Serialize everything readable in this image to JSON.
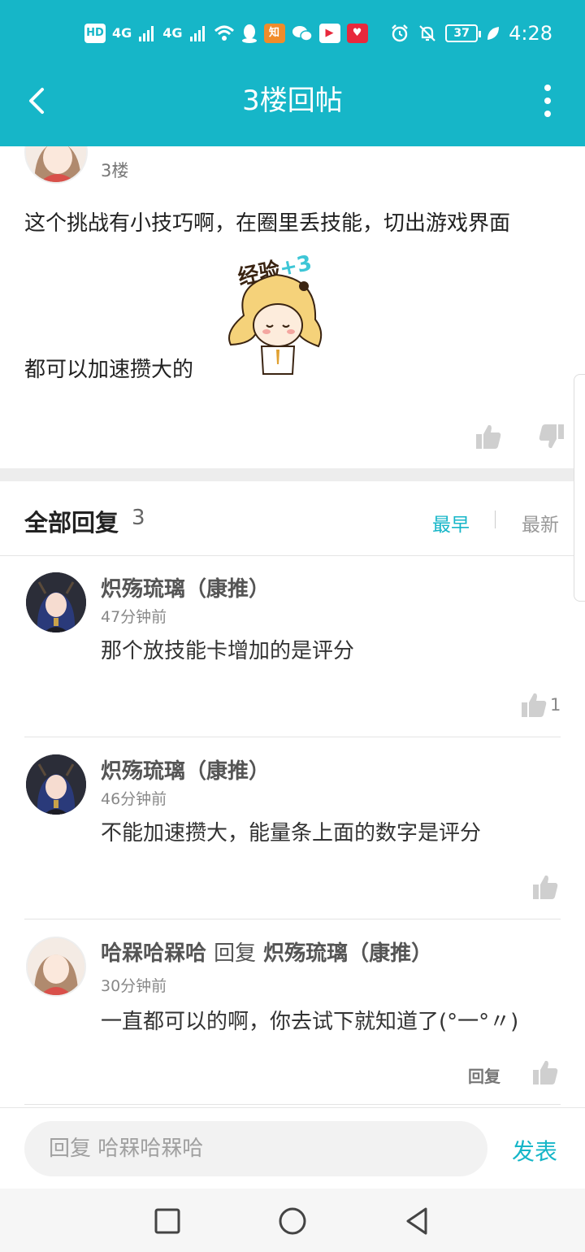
{
  "status_bar": {
    "left_icons": [
      "hd-icon",
      "signal-4g-icon",
      "signal-4g-icon",
      "wifi-icon",
      "qq-icon",
      "zhihu-icon",
      "wechat-icon",
      "video-app-icon",
      "game-app-icon"
    ],
    "hd_label": "HD",
    "net_label_1": "4G",
    "net_label_2": "4G",
    "battery": "37",
    "time": "4:28"
  },
  "header": {
    "title": "3楼回帖"
  },
  "post": {
    "floor": "3楼",
    "text_line1": "这个挑战有小技巧啊，在圈里丢技能，切出游戏界面",
    "text_line2": "都可以加速攒大的",
    "sticker_text": "经验",
    "sticker_bonus": "+3"
  },
  "replies_section": {
    "title": "全部回复",
    "count": "3",
    "sort_earliest": "最早",
    "sort_latest": "最新"
  },
  "replies": [
    {
      "name": "炽殇琉璃（康推）",
      "time": "47分钟前",
      "text": "那个放技能卡增加的是评分",
      "likes": "1"
    },
    {
      "name": "炽殇琉璃（康推）",
      "time": "46分钟前",
      "text": "不能加速攒大，能量条上面的数字是评分",
      "likes": ""
    },
    {
      "name": "哈槑哈槑哈",
      "reply_word": "回复",
      "reply_to": "炽殇琉璃（康推）",
      "time": "30分钟前",
      "text": "一直都可以的啊，你去试下就知道了(°一°〃)",
      "reply_label": "回复"
    }
  ],
  "input": {
    "placeholder": "回复 哈槑哈槑哈",
    "publish_label": "发表"
  },
  "colors": {
    "accent": "#16b6c8",
    "divider": "#e4e4e4"
  }
}
